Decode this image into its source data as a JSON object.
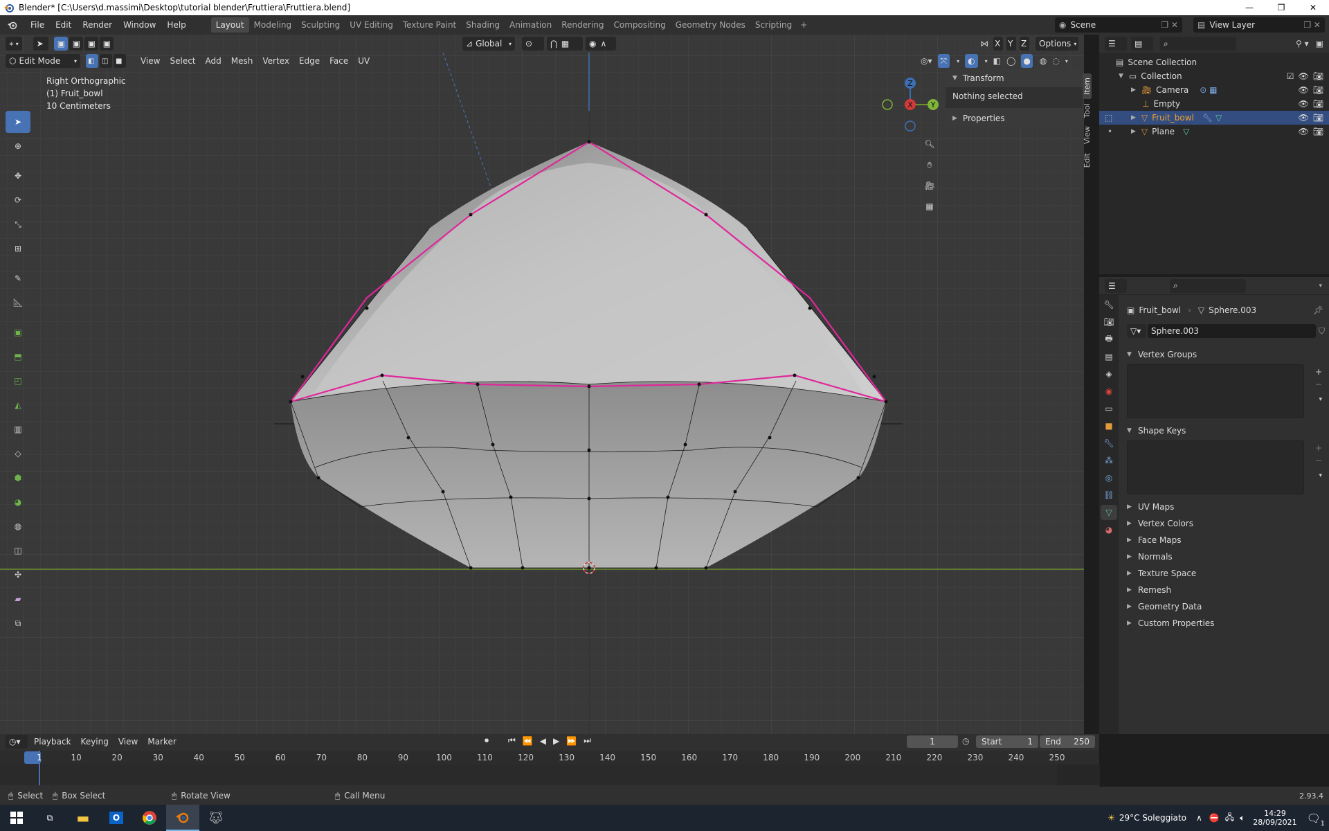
{
  "window": {
    "title": "Blender* [C:\\Users\\d.massimi\\Desktop\\tutorial blender\\Fruttiera\\Fruttiera.blend]"
  },
  "menus": [
    "File",
    "Edit",
    "Render",
    "Window",
    "Help"
  ],
  "workspaces": [
    "Layout",
    "Modeling",
    "Sculpting",
    "UV Editing",
    "Texture Paint",
    "Shading",
    "Animation",
    "Rendering",
    "Compositing",
    "Geometry Nodes",
    "Scripting"
  ],
  "active_workspace": "Layout",
  "scene": {
    "name": "Scene",
    "view_layer": "View Layer"
  },
  "viewport": {
    "mode": "Edit Mode",
    "header_menus": [
      "View",
      "Select",
      "Add",
      "Mesh",
      "Vertex",
      "Edge",
      "Face",
      "UV"
    ],
    "orientation": "Global",
    "options_label": "Options",
    "axes": [
      "X",
      "Y",
      "Z"
    ],
    "info_view": "Right Orthographic",
    "info_object": "(1) Fruit_bowl",
    "info_scale": "10 Centimeters",
    "gizmo": {
      "z": "Z",
      "x": "X",
      "y": "Y"
    }
  },
  "npanel": {
    "transform_title": "Transform",
    "transform_body": "Nothing selected",
    "properties_title": "Properties",
    "tabs": [
      "Item",
      "Tool",
      "View",
      "Edit"
    ]
  },
  "outliner": {
    "root": "Scene Collection",
    "collection": "Collection",
    "items": [
      {
        "name": "Camera",
        "selected": false
      },
      {
        "name": "Empty",
        "selected": false
      },
      {
        "name": "Fruit_bowl",
        "selected": true
      },
      {
        "name": "Plane",
        "selected": false
      }
    ]
  },
  "properties": {
    "object": "Fruit_bowl",
    "mesh": "Sphere.003",
    "datablock": "Sphere.003",
    "panels_open": [
      "Vertex Groups",
      "Shape Keys"
    ],
    "panels_closed": [
      "UV Maps",
      "Vertex Colors",
      "Face Maps",
      "Normals",
      "Texture Space",
      "Remesh",
      "Geometry Data",
      "Custom Properties"
    ]
  },
  "timeline": {
    "menus": [
      "Playback",
      "Keying",
      "View",
      "Marker"
    ],
    "current_frame": "1",
    "start_label": "Start",
    "start": "1",
    "end_label": "End",
    "end": "250",
    "ticks": [
      "1",
      "10",
      "20",
      "30",
      "40",
      "50",
      "60",
      "70",
      "80",
      "90",
      "100",
      "110",
      "120",
      "130",
      "140",
      "150",
      "160",
      "170",
      "180",
      "190",
      "200",
      "210",
      "220",
      "230",
      "240",
      "250"
    ]
  },
  "statusbar": {
    "select": "Select",
    "box_select": "Box Select",
    "rotate_view": "Rotate View",
    "call_menu": "Call Menu",
    "version": "2.93.4"
  },
  "taskbar": {
    "weather": "29°C Soleggiato",
    "time": "14:29",
    "date": "28/09/2021",
    "notifications": "1"
  }
}
